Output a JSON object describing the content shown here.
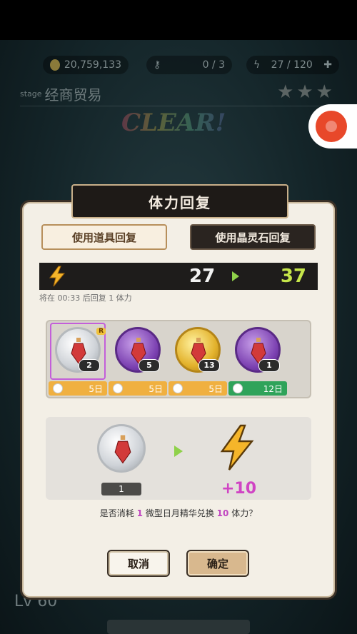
{
  "hud": {
    "gold": "20,759,133",
    "keys": "0 / 3",
    "energy": "27 / 120"
  },
  "stage": {
    "prefix": "stage",
    "name": "经商贸易",
    "stars": "★★★",
    "clear_banner": "CLEAR!"
  },
  "background": {
    "lv_label": "Lv 60"
  },
  "dialog": {
    "title": "体力回复",
    "tabs": [
      {
        "label": "使用道具回复",
        "active": true
      },
      {
        "label": "使用晶灵石回复",
        "active": false
      }
    ],
    "energy_current": "27",
    "energy_after": "37",
    "recover_note": "将在 00:33 后回复 1 体力",
    "items": [
      {
        "icon": "silver-potion-icon",
        "count": "2",
        "expiry": "5日",
        "tag": "R",
        "selected": true
      },
      {
        "icon": "purple-potion-icon",
        "count": "5",
        "expiry": "5日"
      },
      {
        "icon": "gold-potion-icon",
        "count": "13",
        "expiry": "5日"
      },
      {
        "icon": "purple-potion-icon",
        "count": "1",
        "expiry": "12日"
      }
    ],
    "use_quantity": "1",
    "gain": "+10",
    "question_pre": "是否消耗",
    "question_qty": "1",
    "question_mid": "微型日月精华兑换",
    "question_amount": "10",
    "question_post": "体力？",
    "cancel_label": "取消",
    "confirm_label": "确定"
  },
  "colors": {
    "accent_green": "#c6e64a",
    "accent_purple": "#c046c0",
    "exp_orange": "#f0b040",
    "exp_green": "#2fa35a"
  }
}
